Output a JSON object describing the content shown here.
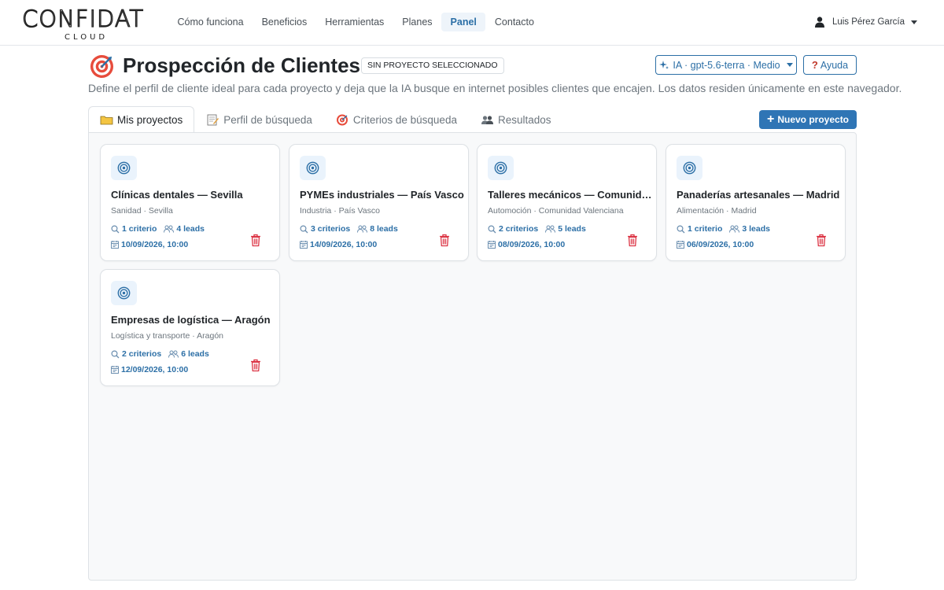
{
  "brand": {
    "name": "CONFIDAT",
    "sub": "CLOUD"
  },
  "nav": [
    {
      "label": "Cómo funciona"
    },
    {
      "label": "Beneficios"
    },
    {
      "label": "Herramientas"
    },
    {
      "label": "Planes"
    },
    {
      "label": "Panel",
      "active": true
    },
    {
      "label": "Contacto"
    }
  ],
  "user": {
    "name": "Luis Pérez García"
  },
  "header": {
    "title": "Prospección de Clientes",
    "badge": "SIN PROYECTO SELECCIONADO",
    "ai_label": "IA · gpt-5.6-terra · Medio",
    "help_label": "Ayuda",
    "subtitle": "Define el perfil de cliente ideal para cada proyecto y deja que la IA busque en internet posibles clientes que encajen. Los datos residen únicamente en este navegador."
  },
  "tabs": [
    {
      "label": "Mis proyectos",
      "icon": "folder-icon",
      "active": true
    },
    {
      "label": "Perfil de búsqueda",
      "icon": "memo-icon"
    },
    {
      "label": "Criterios de búsqueda",
      "icon": "target-icon"
    },
    {
      "label": "Resultados",
      "icon": "people-icon"
    }
  ],
  "new_project_label": "Nuevo proyecto",
  "projects": [
    {
      "title": "Clínicas dentales — Sevilla",
      "meta": "Sanidad · Sevilla",
      "criteria": "1 criterio",
      "leads": "4 leads",
      "date": "10/09/2026, 10:00"
    },
    {
      "title": "PYMEs industriales — País Vasco",
      "meta": "Industria · País Vasco",
      "criteria": "3 criterios",
      "leads": "8 leads",
      "date": "14/09/2026, 10:00"
    },
    {
      "title": "Talleres mecánicos — Comunidad Valenciana",
      "meta": "Automoción · Comunidad Valenciana",
      "criteria": "2 criterios",
      "leads": "5 leads",
      "date": "08/09/2026, 10:00"
    },
    {
      "title": "Panaderías artesanales — Madrid",
      "meta": "Alimentación · Madrid",
      "criteria": "1 criterio",
      "leads": "3 leads",
      "date": "06/09/2026, 10:00"
    },
    {
      "title": "Empresas de logística — Aragón",
      "meta": "Logística y transporte · Aragón",
      "criteria": "2 criterios",
      "leads": "6 leads",
      "date": "12/09/2026, 10:00"
    }
  ],
  "colors": {
    "accent": "#2c6fa6",
    "primary_button": "#2f75b5",
    "delete": "#dc3545",
    "card_icon_bg": "#eaf3fc"
  }
}
